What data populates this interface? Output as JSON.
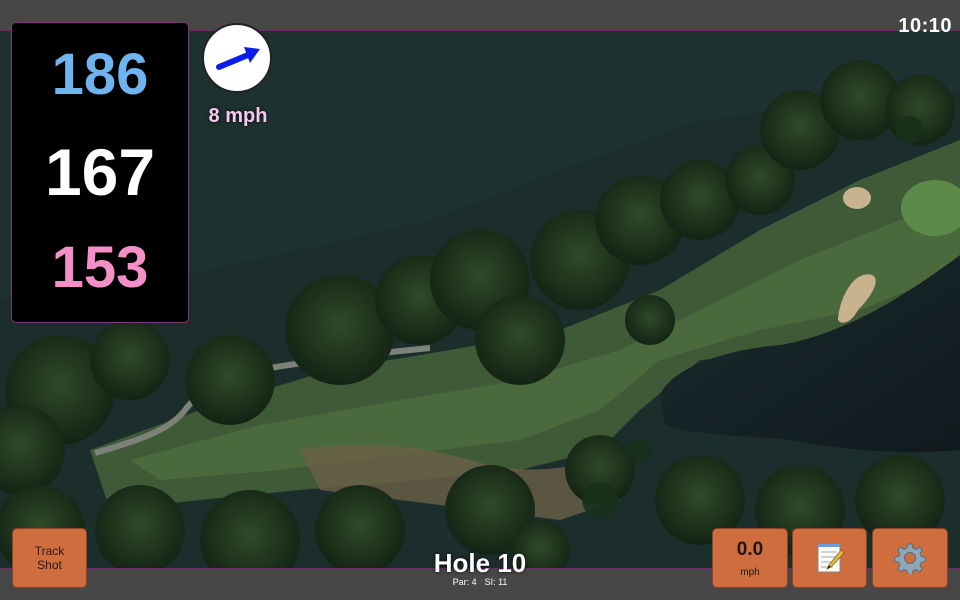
{
  "status_bar": {
    "time": "10:10"
  },
  "yardages": {
    "back": "186",
    "middle": "167",
    "front": "153"
  },
  "wind": {
    "speed_label": "8 mph",
    "arrow_icon": "wind-direction-arrow-icon",
    "color": "#0a1ee8"
  },
  "controls": {
    "track_shot_label": "Track\nShot",
    "speed_value": "0.0",
    "speed_unit": "mph",
    "notes_icon": "notepad-icon",
    "settings_icon": "gear-icon"
  },
  "hole": {
    "title": "Hole 10",
    "par_label": "Par: 4",
    "si_label": "SI: 11"
  },
  "colors": {
    "accent_button": "#cf6d3f",
    "back_yardage": "#6fb3ef",
    "middle_yardage": "#ffffff",
    "front_yardage": "#f58fc8",
    "panel_border": "#7a3a7a"
  }
}
